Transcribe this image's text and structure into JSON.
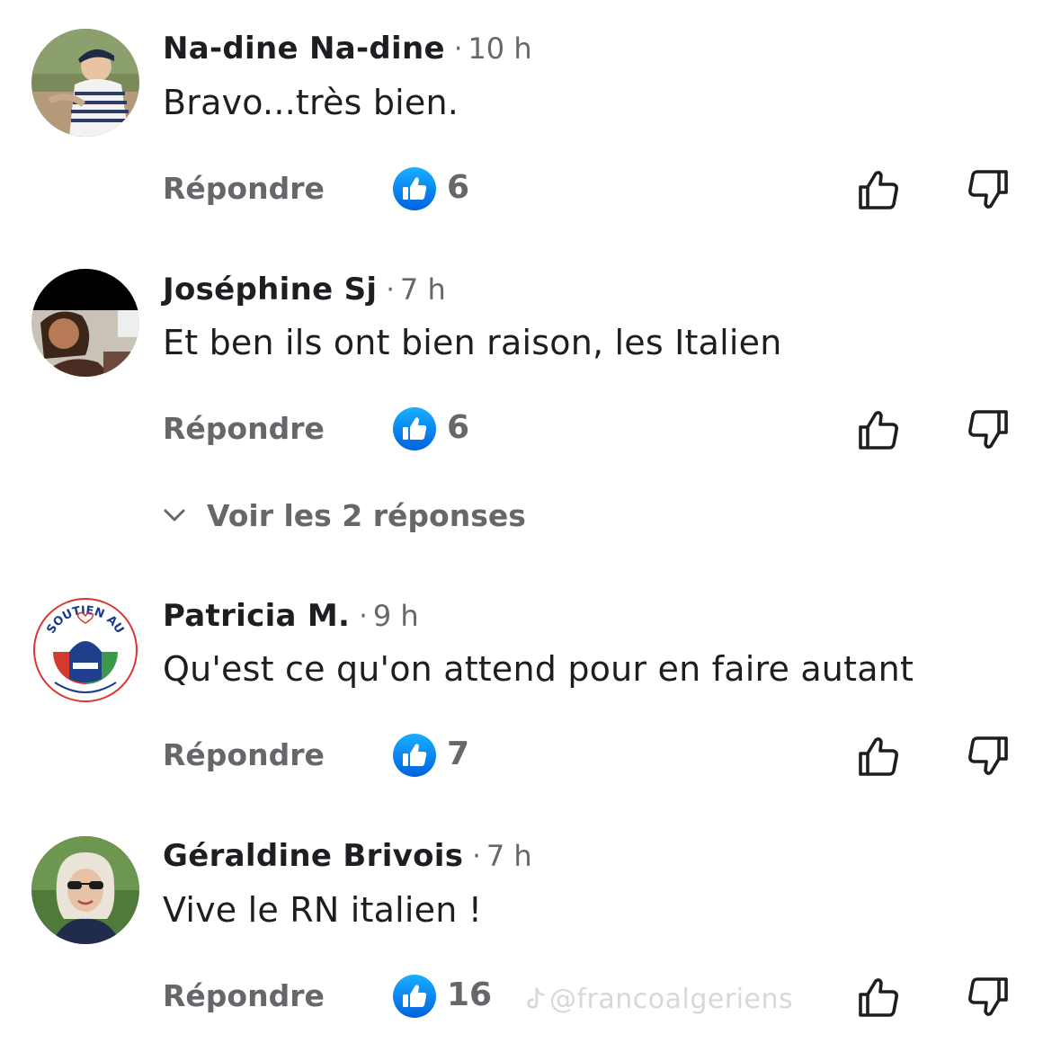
{
  "comments": [
    {
      "author": "Na-dine Na-dine",
      "separator": "·",
      "time": "10 h",
      "text": "Bravo...très bien.",
      "reply_label": "Répondre",
      "likes": "6"
    },
    {
      "author": "Joséphine Sj",
      "separator": "·",
      "time": "7 h",
      "text": "Et ben ils ont bien raison, les Italien",
      "reply_label": "Répondre",
      "likes": "6",
      "replies_label": "Voir les 2 réponses"
    },
    {
      "author": "Patricia M.",
      "separator": "·",
      "time": "9 h",
      "text": "Qu'est ce qu'on attend pour en faire autant",
      "reply_label": "Répondre",
      "likes": "7",
      "avatar_text": "SOUTIEN AU"
    },
    {
      "author": "Géraldine Brivois",
      "separator": "·",
      "time": "7 h",
      "text": "Vive le RN italien !",
      "reply_label": "Répondre",
      "likes": "16"
    }
  ],
  "watermark": "@francoalgeriens",
  "colors": {
    "primary_text": "#1c1e21",
    "secondary_text": "#65676b",
    "like_blue": "#1877f2"
  },
  "icons": {
    "like_badge": "like-badge-icon",
    "thumb_up": "thumb-up-icon",
    "thumb_down": "thumb-down-icon",
    "chevron": "chevron-down-icon",
    "tiktok": "tiktok-icon"
  }
}
